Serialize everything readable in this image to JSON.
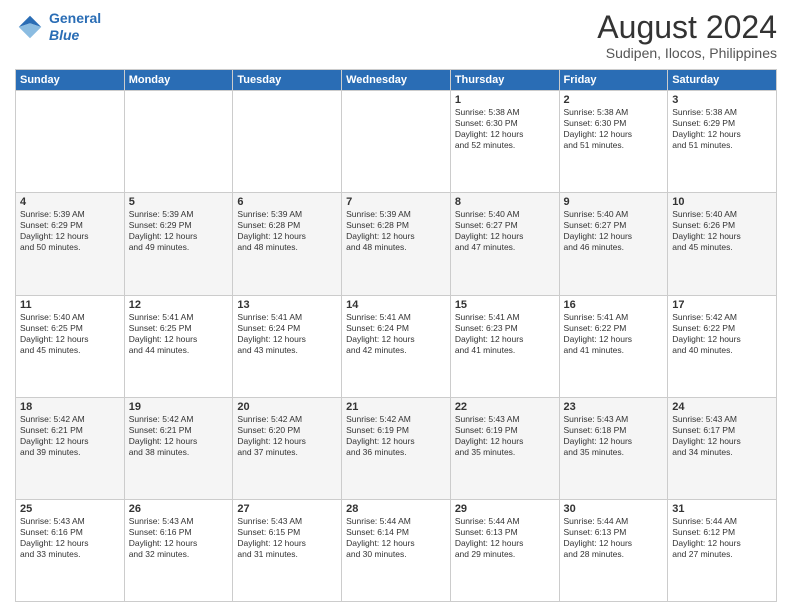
{
  "header": {
    "logo_line1": "General",
    "logo_line2": "Blue",
    "title": "August 2024",
    "subtitle": "Sudipen, Ilocos, Philippines"
  },
  "days_of_week": [
    "Sunday",
    "Monday",
    "Tuesday",
    "Wednesday",
    "Thursday",
    "Friday",
    "Saturday"
  ],
  "weeks": [
    [
      {
        "day": "",
        "info": ""
      },
      {
        "day": "",
        "info": ""
      },
      {
        "day": "",
        "info": ""
      },
      {
        "day": "",
        "info": ""
      },
      {
        "day": "1",
        "info": "Sunrise: 5:38 AM\nSunset: 6:30 PM\nDaylight: 12 hours\nand 52 minutes."
      },
      {
        "day": "2",
        "info": "Sunrise: 5:38 AM\nSunset: 6:30 PM\nDaylight: 12 hours\nand 51 minutes."
      },
      {
        "day": "3",
        "info": "Sunrise: 5:38 AM\nSunset: 6:29 PM\nDaylight: 12 hours\nand 51 minutes."
      }
    ],
    [
      {
        "day": "4",
        "info": "Sunrise: 5:39 AM\nSunset: 6:29 PM\nDaylight: 12 hours\nand 50 minutes."
      },
      {
        "day": "5",
        "info": "Sunrise: 5:39 AM\nSunset: 6:29 PM\nDaylight: 12 hours\nand 49 minutes."
      },
      {
        "day": "6",
        "info": "Sunrise: 5:39 AM\nSunset: 6:28 PM\nDaylight: 12 hours\nand 48 minutes."
      },
      {
        "day": "7",
        "info": "Sunrise: 5:39 AM\nSunset: 6:28 PM\nDaylight: 12 hours\nand 48 minutes."
      },
      {
        "day": "8",
        "info": "Sunrise: 5:40 AM\nSunset: 6:27 PM\nDaylight: 12 hours\nand 47 minutes."
      },
      {
        "day": "9",
        "info": "Sunrise: 5:40 AM\nSunset: 6:27 PM\nDaylight: 12 hours\nand 46 minutes."
      },
      {
        "day": "10",
        "info": "Sunrise: 5:40 AM\nSunset: 6:26 PM\nDaylight: 12 hours\nand 45 minutes."
      }
    ],
    [
      {
        "day": "11",
        "info": "Sunrise: 5:40 AM\nSunset: 6:25 PM\nDaylight: 12 hours\nand 45 minutes."
      },
      {
        "day": "12",
        "info": "Sunrise: 5:41 AM\nSunset: 6:25 PM\nDaylight: 12 hours\nand 44 minutes."
      },
      {
        "day": "13",
        "info": "Sunrise: 5:41 AM\nSunset: 6:24 PM\nDaylight: 12 hours\nand 43 minutes."
      },
      {
        "day": "14",
        "info": "Sunrise: 5:41 AM\nSunset: 6:24 PM\nDaylight: 12 hours\nand 42 minutes."
      },
      {
        "day": "15",
        "info": "Sunrise: 5:41 AM\nSunset: 6:23 PM\nDaylight: 12 hours\nand 41 minutes."
      },
      {
        "day": "16",
        "info": "Sunrise: 5:41 AM\nSunset: 6:22 PM\nDaylight: 12 hours\nand 41 minutes."
      },
      {
        "day": "17",
        "info": "Sunrise: 5:42 AM\nSunset: 6:22 PM\nDaylight: 12 hours\nand 40 minutes."
      }
    ],
    [
      {
        "day": "18",
        "info": "Sunrise: 5:42 AM\nSunset: 6:21 PM\nDaylight: 12 hours\nand 39 minutes."
      },
      {
        "day": "19",
        "info": "Sunrise: 5:42 AM\nSunset: 6:21 PM\nDaylight: 12 hours\nand 38 minutes."
      },
      {
        "day": "20",
        "info": "Sunrise: 5:42 AM\nSunset: 6:20 PM\nDaylight: 12 hours\nand 37 minutes."
      },
      {
        "day": "21",
        "info": "Sunrise: 5:42 AM\nSunset: 6:19 PM\nDaylight: 12 hours\nand 36 minutes."
      },
      {
        "day": "22",
        "info": "Sunrise: 5:43 AM\nSunset: 6:19 PM\nDaylight: 12 hours\nand 35 minutes."
      },
      {
        "day": "23",
        "info": "Sunrise: 5:43 AM\nSunset: 6:18 PM\nDaylight: 12 hours\nand 35 minutes."
      },
      {
        "day": "24",
        "info": "Sunrise: 5:43 AM\nSunset: 6:17 PM\nDaylight: 12 hours\nand 34 minutes."
      }
    ],
    [
      {
        "day": "25",
        "info": "Sunrise: 5:43 AM\nSunset: 6:16 PM\nDaylight: 12 hours\nand 33 minutes."
      },
      {
        "day": "26",
        "info": "Sunrise: 5:43 AM\nSunset: 6:16 PM\nDaylight: 12 hours\nand 32 minutes."
      },
      {
        "day": "27",
        "info": "Sunrise: 5:43 AM\nSunset: 6:15 PM\nDaylight: 12 hours\nand 31 minutes."
      },
      {
        "day": "28",
        "info": "Sunrise: 5:44 AM\nSunset: 6:14 PM\nDaylight: 12 hours\nand 30 minutes."
      },
      {
        "day": "29",
        "info": "Sunrise: 5:44 AM\nSunset: 6:13 PM\nDaylight: 12 hours\nand 29 minutes."
      },
      {
        "day": "30",
        "info": "Sunrise: 5:44 AM\nSunset: 6:13 PM\nDaylight: 12 hours\nand 28 minutes."
      },
      {
        "day": "31",
        "info": "Sunrise: 5:44 AM\nSunset: 6:12 PM\nDaylight: 12 hours\nand 27 minutes."
      }
    ]
  ]
}
